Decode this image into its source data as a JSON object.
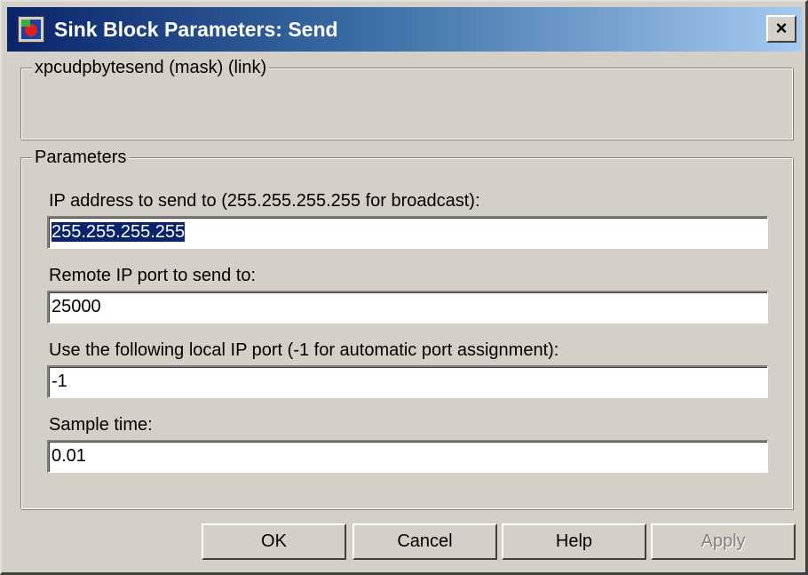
{
  "window": {
    "title": "Sink Block Parameters: Send",
    "app_icon": "simulink-block-icon",
    "close_glyph": "×"
  },
  "description_group": {
    "legend": "xpcudpbytesend (mask) (link)"
  },
  "parameters_group": {
    "legend": "Parameters",
    "fields": [
      {
        "label": "IP address to send to (255.255.255.255 for broadcast):",
        "value": "255.255.255.255",
        "selected": true
      },
      {
        "label": "Remote IP port to send to:",
        "value": "25000"
      },
      {
        "label": "Use the following local IP port (-1 for automatic port assignment):",
        "value": "-1"
      },
      {
        "label": "Sample time:",
        "value": "0.01"
      }
    ]
  },
  "buttons": {
    "ok": "OK",
    "cancel": "Cancel",
    "help": "Help",
    "apply": "Apply"
  },
  "colors": {
    "titlebar_start": "#0a246a",
    "titlebar_end": "#a6caf0",
    "dialog_bg": "#d4d0c8",
    "selection_bg": "#0a246a"
  }
}
